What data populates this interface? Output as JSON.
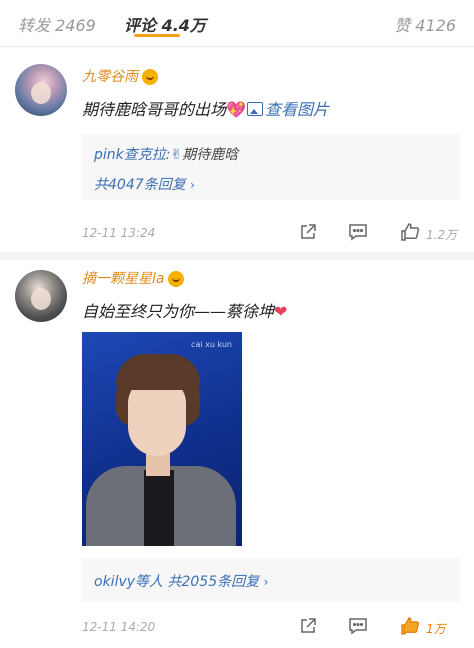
{
  "tabs": {
    "repost": "转发 2469",
    "comment": "评论 4.4万",
    "like": "赞 4126"
  },
  "comments": [
    {
      "username": "九零谷雨",
      "text": "期待鹿晗哥哥的出场",
      "view_image": "查看图片",
      "reply": {
        "author": "pink查克拉:",
        "text": "期待鹿晗"
      },
      "more_replies": "共4047条回复",
      "time": "12-11 13:24",
      "likes": "1.2万"
    },
    {
      "username": "摘一颗星星la",
      "text": "自始至终只为你——蔡徐坤",
      "image_watermark": "cai xu kun",
      "more_replies": "okilvy等人 共2055条回复",
      "time": "12-11 14:20",
      "likes": "1万"
    }
  ],
  "colors": {
    "accent": "#f7a11a",
    "username": "#e08a1e",
    "link": "#3b6fb5",
    "liked": "#f07c00"
  }
}
